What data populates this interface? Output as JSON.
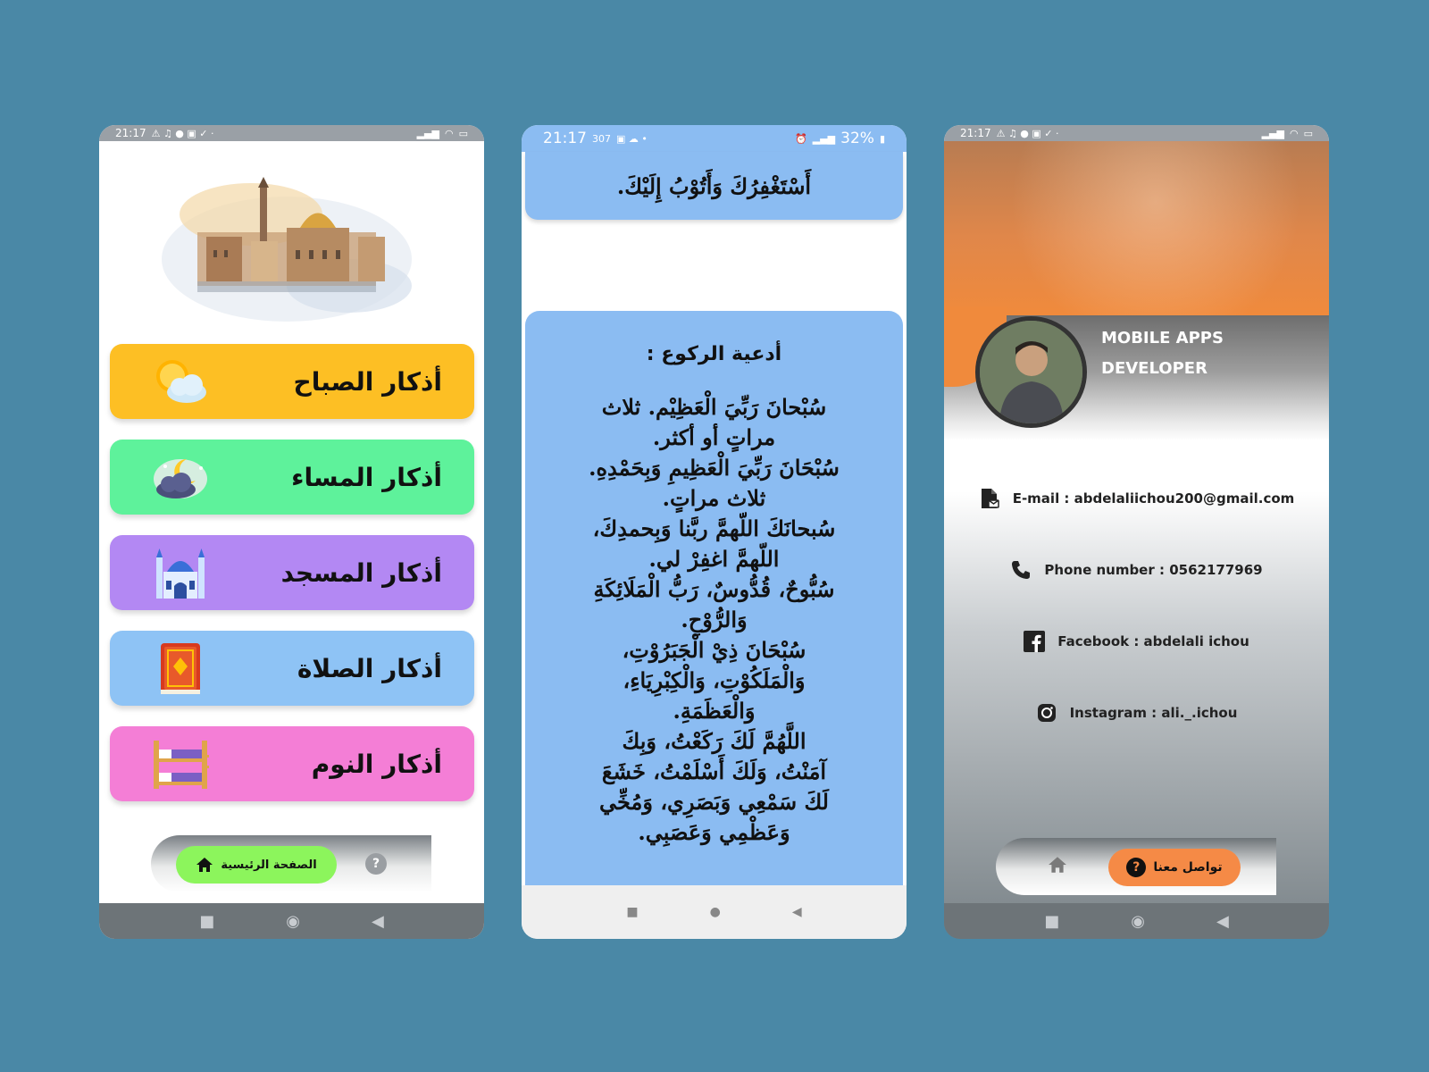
{
  "statusbar": {
    "time": "21:17",
    "battery_pct": "32%",
    "speed": "307"
  },
  "home": {
    "menu": [
      {
        "label": "أذكار الصباح",
        "color": "#fdbf24",
        "icon": "sun-cloud-icon"
      },
      {
        "label": "أذكار المساء",
        "color": "#5ef29b",
        "icon": "moon-cloud-icon"
      },
      {
        "label": "أذكار المسجد",
        "color": "#b388f3",
        "icon": "mosque-icon"
      },
      {
        "label": "أذكار الصلاة",
        "color": "#8ec3f5",
        "icon": "quran-book-icon"
      },
      {
        "label": "أذكار النوم",
        "color": "#f47ed6",
        "icon": "bunk-bed-icon"
      }
    ],
    "nav": {
      "home_label": "الصفحة الرئيسية",
      "help_symbol": "?",
      "home_pill_color": "#8cf55c"
    }
  },
  "dua": {
    "top_line": "أَسْتَغْفِرُكَ وَأَتُوْبُ إِلَيْكَ.",
    "title": "أدعية الركوع :",
    "body": "سُبْحانَ رَبِّيَ الْعَظِيْم. ثلاث\nمراتٍ أو أكثر.\nسُبْحَانَ رَبِّيَ الْعَظِيمِ وَبِحَمْدِهِ.\nثلاث مراتٍ.\nسُبحانَكَ اللّهمَّ ربَّنا وَبِحمدِكَ،\nاللّهمَّ اغفِرْ لي.\nسُبُّوحٌ، قُدُّوسٌ، رَبُّ الْمَلَائِكَةِ\nوَالرُّوْحِ.\nسُبْحَانَ ذِيْ الْجَبَرُوْتِ،\nوَالْمَلَكُوْتِ، وَالْكِبْرِيَاءِ،\nوَالْعَظَمَةِ.\nاللَّهُمَّ لَكَ رَكَعْتُ، وَبِكَ\nآمَنْتُ، وَلَكَ أَسْلَمْتُ، خَشَعَ\nلَكَ سَمْعِي وَبَصَرِي، وَمُخِّي\nوَعَظْمِي وَعَصَبِي.",
    "card_color": "#8bbcf2"
  },
  "profile": {
    "title_line1": "MOBILE APPS",
    "title_line2": "DEVELOPER",
    "contacts": [
      {
        "label": "E-mail : abdelaliichou200@gmail.com",
        "icon": "email-document-icon"
      },
      {
        "label": "Phone number : 0562177969",
        "icon": "phone-icon"
      },
      {
        "label": "Facebook : abdelali ichou",
        "icon": "facebook-icon"
      },
      {
        "label": "Instagram : ali._.ichou",
        "icon": "instagram-icon"
      }
    ],
    "nav": {
      "contact_label": "تواصل معنا",
      "help_symbol": "?",
      "pill_color": "#f58a46"
    }
  }
}
